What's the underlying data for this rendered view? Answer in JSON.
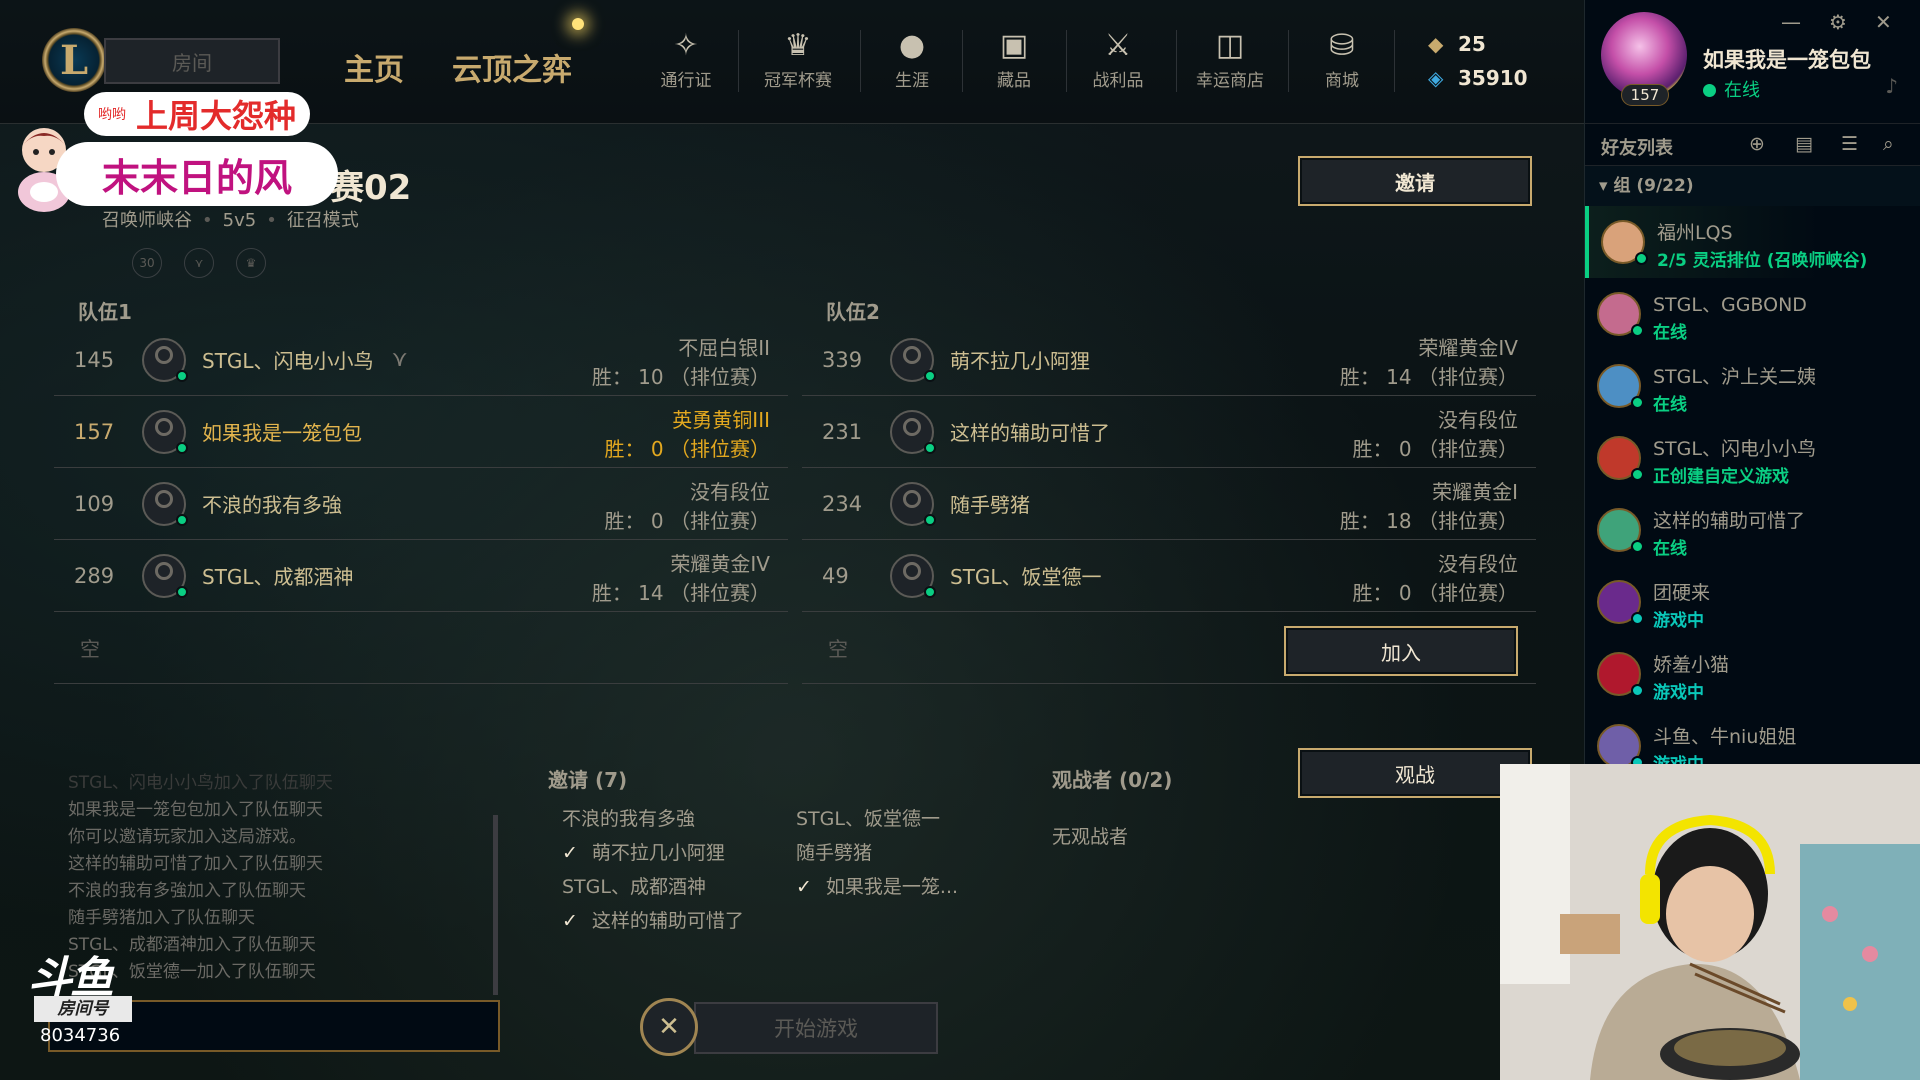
{
  "topbar": {
    "room_button": "房间",
    "main_nav": [
      "主页",
      "云顶之弈"
    ],
    "nav_items": [
      {
        "label": "通行证",
        "icon": "pass-icon"
      },
      {
        "label": "冠军杯赛",
        "icon": "trophy-icon"
      },
      {
        "label": "生涯",
        "icon": "profile-icon"
      },
      {
        "label": "藏品",
        "icon": "collection-icon"
      },
      {
        "label": "战利品",
        "icon": "loot-icon"
      },
      {
        "label": "幸运商店",
        "icon": "lucky-shop-icon"
      },
      {
        "label": "商城",
        "icon": "store-icon"
      }
    ],
    "currency": {
      "rp": "25",
      "be": "35910"
    }
  },
  "overlay": {
    "badge_small": "哟哟",
    "badge_top": "上周大怨种",
    "badge_name": "末末日的风",
    "douyu_logo": "斗鱼",
    "room_tag": "房间号",
    "room_number": "8034736"
  },
  "lobby": {
    "title": "赛02",
    "map": "召唤师峡谷",
    "size": "5v5",
    "mode": "征召模式",
    "icon_30": "30",
    "invite_button": "邀请",
    "join_button": "加入",
    "spectate_button": "观战",
    "start_button": "开始游戏",
    "team1_label": "队伍1",
    "team2_label": "队伍2",
    "empty_label": "空",
    "team1": [
      {
        "level": "145",
        "name": "STGL、闪电小小鸟",
        "rank": "不屈白银II",
        "wins": "胜：  10  （排位赛）",
        "me": false,
        "role_icon": true
      },
      {
        "level": "157",
        "name": "如果我是一笼包包",
        "rank": "英勇黄铜III",
        "wins": "胜：  0  （排位赛）",
        "me": true,
        "role_icon": false
      },
      {
        "level": "109",
        "name": "不浪的我有多強",
        "rank": "没有段位",
        "wins": "胜：  0  （排位赛）",
        "me": false,
        "role_icon": false
      },
      {
        "level": "289",
        "name": "STGL、成都酒神",
        "rank": "荣耀黄金IV",
        "wins": "胜：  14  （排位赛）",
        "me": false,
        "role_icon": false
      }
    ],
    "team2": [
      {
        "level": "339",
        "name": "萌不拉几小阿狸",
        "rank": "荣耀黄金IV",
        "wins": "胜：  14  （排位赛）"
      },
      {
        "level": "231",
        "name": "这样的辅助可惜了",
        "rank": "没有段位",
        "wins": "胜：  0  （排位赛）"
      },
      {
        "level": "234",
        "name": "随手劈猪",
        "rank": "荣耀黄金I",
        "wins": "胜：  18  （排位赛）"
      },
      {
        "level": "49",
        "name": "STGL、饭堂德一",
        "rank": "没有段位",
        "wins": "胜：  0  （排位赛）"
      }
    ],
    "chat": [
      "STGL、闪电小小鸟加入了队伍聊天",
      "如果我是一笼包包加入了队伍聊天",
      "你可以邀请玩家加入这局游戏。",
      "这样的辅助可惜了加入了队伍聊天",
      "不浪的我有多強加入了队伍聊天",
      "随手劈猪加入了队伍聊天",
      "STGL、成都酒神加入了队伍聊天",
      "STGL、饭堂德一加入了队伍聊天"
    ],
    "invites_title": "邀请 (7)",
    "invites": [
      {
        "name": "不浪的我有多強",
        "check": false
      },
      {
        "name": "STGL、饭堂德一",
        "check": false
      },
      {
        "name": "萌不拉几小阿狸",
        "check": true
      },
      {
        "name": "随手劈猪",
        "check": false
      },
      {
        "name": "STGL、成都酒神",
        "check": false
      },
      {
        "name": "如果我是一笼...",
        "check": true
      },
      {
        "name": "这样的辅助可惜了",
        "check": true
      }
    ],
    "spectators_title": "观战者 (0/2)",
    "spectators_none": "无观战者"
  },
  "sidebar": {
    "me": {
      "name": "如果我是一笼包包",
      "status": "在线",
      "level": "157"
    },
    "friends_title": "好友列表",
    "group": "组 (9/22)",
    "friends": [
      {
        "name": "福州LQS",
        "status": "2/5 灵活排位 (召唤师峡谷)",
        "kind": "online",
        "color": "#d9a27a"
      },
      {
        "name": "STGL、GGBOND",
        "status": "在线",
        "kind": "online",
        "color": "#c46b8e"
      },
      {
        "name": "STGL、沪上关二姨",
        "status": "在线",
        "kind": "online",
        "color": "#4d8fc4"
      },
      {
        "name": "STGL、闪电小小鸟",
        "status": "正创建自定义游戏",
        "kind": "custom",
        "color": "#c0392b"
      },
      {
        "name": "这样的辅助可惜了",
        "status": "在线",
        "kind": "online",
        "color": "#3fa37a"
      },
      {
        "name": "团硬来",
        "status": "游戏中",
        "kind": "ingame",
        "color": "#6a2a8c"
      },
      {
        "name": "娇羞小猫",
        "status": "游戏中",
        "kind": "ingame",
        "color": "#b0182d"
      },
      {
        "name": "斗鱼、牛niu姐姐",
        "status": "游戏中",
        "kind": "ingame",
        "color": "#6f5fa8"
      }
    ]
  },
  "colors": {
    "gold": "#c8aa6e",
    "online": "#0acf83",
    "ingame": "#0ac8b9",
    "bg": "#010a13"
  }
}
